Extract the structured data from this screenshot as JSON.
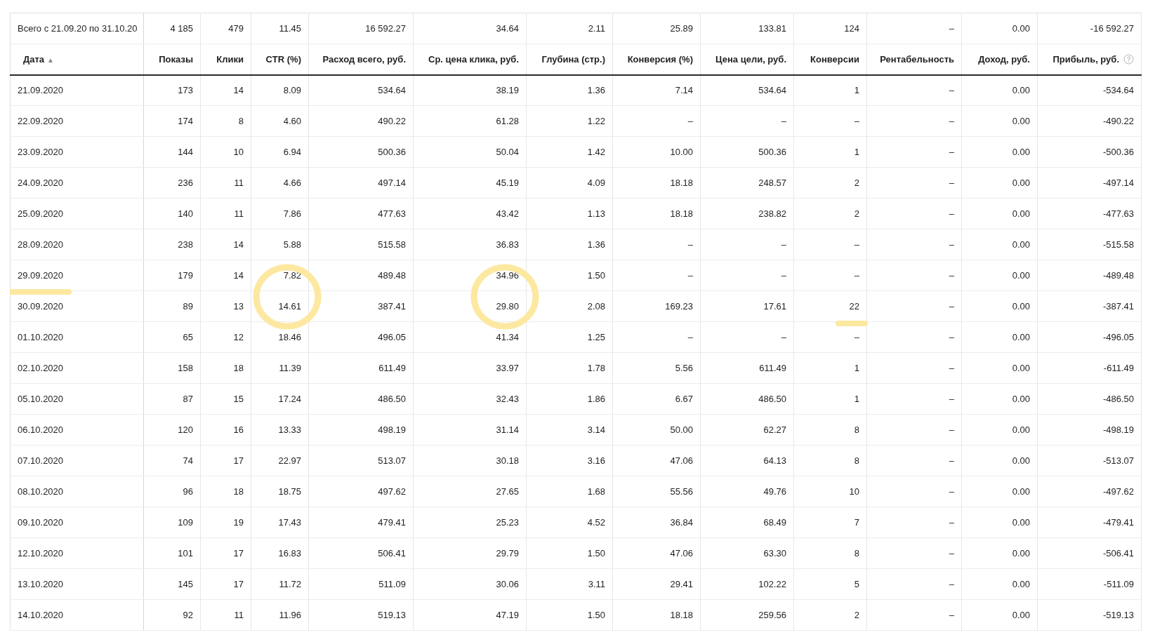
{
  "table": {
    "totals": [
      "Всего с 21.09.20 по 31.10.20",
      "4 185",
      "479",
      "11.45",
      "16 592.27",
      "34.64",
      "2.11",
      "25.89",
      "133.81",
      "124",
      "–",
      "0.00",
      "-16 592.27"
    ],
    "columns": [
      {
        "label": "Дата",
        "sort_indicator": "▲",
        "help_icon": false
      },
      {
        "label": "Показы",
        "help_icon": false
      },
      {
        "label": "Клики",
        "help_icon": false
      },
      {
        "label": "CTR (%)",
        "help_icon": false
      },
      {
        "label": "Расход всего, руб.",
        "help_icon": false
      },
      {
        "label": "Ср. цена клика, руб.",
        "help_icon": false
      },
      {
        "label": "Глубина (стр.)",
        "help_icon": false
      },
      {
        "label": "Конверсия (%)",
        "help_icon": false
      },
      {
        "label": "Цена цели, руб.",
        "help_icon": false
      },
      {
        "label": "Конверсии",
        "help_icon": false
      },
      {
        "label": "Рентабельность",
        "help_icon": false
      },
      {
        "label": "Доход, руб.",
        "help_icon": false
      },
      {
        "label": "Прибыль, руб.",
        "help_icon": true
      }
    ],
    "rows": [
      {
        "cells": [
          "21.09.2020",
          "173",
          "14",
          "8.09",
          "534.64",
          "38.19",
          "1.36",
          "7.14",
          "534.64",
          "1",
          "–",
          "0.00",
          "-534.64"
        ],
        "date_underlined": false,
        "ctr_circled": false,
        "cpc_circled": false,
        "conversions_underlined": false
      },
      {
        "cells": [
          "22.09.2020",
          "174",
          "8",
          "4.60",
          "490.22",
          "61.28",
          "1.22",
          "–",
          "–",
          "–",
          "–",
          "0.00",
          "-490.22"
        ],
        "date_underlined": false,
        "ctr_circled": false,
        "cpc_circled": false,
        "conversions_underlined": false
      },
      {
        "cells": [
          "23.09.2020",
          "144",
          "10",
          "6.94",
          "500.36",
          "50.04",
          "1.42",
          "10.00",
          "500.36",
          "1",
          "–",
          "0.00",
          "-500.36"
        ],
        "date_underlined": false,
        "ctr_circled": false,
        "cpc_circled": false,
        "conversions_underlined": false
      },
      {
        "cells": [
          "24.09.2020",
          "236",
          "11",
          "4.66",
          "497.14",
          "45.19",
          "4.09",
          "18.18",
          "248.57",
          "2",
          "–",
          "0.00",
          "-497.14"
        ],
        "date_underlined": false,
        "ctr_circled": false,
        "cpc_circled": false,
        "conversions_underlined": false
      },
      {
        "cells": [
          "25.09.2020",
          "140",
          "11",
          "7.86",
          "477.63",
          "43.42",
          "1.13",
          "18.18",
          "238.82",
          "2",
          "–",
          "0.00",
          "-477.63"
        ],
        "date_underlined": false,
        "ctr_circled": false,
        "cpc_circled": false,
        "conversions_underlined": false
      },
      {
        "cells": [
          "28.09.2020",
          "238",
          "14",
          "5.88",
          "515.58",
          "36.83",
          "1.36",
          "–",
          "–",
          "–",
          "–",
          "0.00",
          "-515.58"
        ],
        "date_underlined": false,
        "ctr_circled": false,
        "cpc_circled": false,
        "conversions_underlined": false
      },
      {
        "cells": [
          "29.09.2020",
          "179",
          "14",
          "7.82",
          "489.48",
          "34.96",
          "1.50",
          "–",
          "–",
          "–",
          "–",
          "0.00",
          "-489.48"
        ],
        "date_underlined": true,
        "ctr_circled": true,
        "cpc_circled": true,
        "conversions_underlined": false
      },
      {
        "cells": [
          "30.09.2020",
          "89",
          "13",
          "14.61",
          "387.41",
          "29.80",
          "2.08",
          "169.23",
          "17.61",
          "22",
          "–",
          "0.00",
          "-387.41"
        ],
        "date_underlined": false,
        "ctr_circled": true,
        "cpc_circled": true,
        "conversions_underlined": true
      },
      {
        "cells": [
          "01.10.2020",
          "65",
          "12",
          "18.46",
          "496.05",
          "41.34",
          "1.25",
          "–",
          "–",
          "–",
          "–",
          "0.00",
          "-496.05"
        ],
        "date_underlined": false,
        "ctr_circled": false,
        "cpc_circled": false,
        "conversions_underlined": false
      },
      {
        "cells": [
          "02.10.2020",
          "158",
          "18",
          "11.39",
          "611.49",
          "33.97",
          "1.78",
          "5.56",
          "611.49",
          "1",
          "–",
          "0.00",
          "-611.49"
        ],
        "date_underlined": false,
        "ctr_circled": false,
        "cpc_circled": false,
        "conversions_underlined": false
      },
      {
        "cells": [
          "05.10.2020",
          "87",
          "15",
          "17.24",
          "486.50",
          "32.43",
          "1.86",
          "6.67",
          "486.50",
          "1",
          "–",
          "0.00",
          "-486.50"
        ],
        "date_underlined": false,
        "ctr_circled": false,
        "cpc_circled": false,
        "conversions_underlined": false
      },
      {
        "cells": [
          "06.10.2020",
          "120",
          "16",
          "13.33",
          "498.19",
          "31.14",
          "3.14",
          "50.00",
          "62.27",
          "8",
          "–",
          "0.00",
          "-498.19"
        ],
        "date_underlined": false,
        "ctr_circled": false,
        "cpc_circled": false,
        "conversions_underlined": false
      },
      {
        "cells": [
          "07.10.2020",
          "74",
          "17",
          "22.97",
          "513.07",
          "30.18",
          "3.16",
          "47.06",
          "64.13",
          "8",
          "–",
          "0.00",
          "-513.07"
        ],
        "date_underlined": false,
        "ctr_circled": false,
        "cpc_circled": false,
        "conversions_underlined": false
      },
      {
        "cells": [
          "08.10.2020",
          "96",
          "18",
          "18.75",
          "497.62",
          "27.65",
          "1.68",
          "55.56",
          "49.76",
          "10",
          "–",
          "0.00",
          "-497.62"
        ],
        "date_underlined": false,
        "ctr_circled": false,
        "cpc_circled": false,
        "conversions_underlined": false
      },
      {
        "cells": [
          "09.10.2020",
          "109",
          "19",
          "17.43",
          "479.41",
          "25.23",
          "4.52",
          "36.84",
          "68.49",
          "7",
          "–",
          "0.00",
          "-479.41"
        ],
        "date_underlined": false,
        "ctr_circled": false,
        "cpc_circled": false,
        "conversions_underlined": false
      },
      {
        "cells": [
          "12.10.2020",
          "101",
          "17",
          "16.83",
          "506.41",
          "29.79",
          "1.50",
          "47.06",
          "63.30",
          "8",
          "–",
          "0.00",
          "-506.41"
        ],
        "date_underlined": false,
        "ctr_circled": false,
        "cpc_circled": false,
        "conversions_underlined": false
      },
      {
        "cells": [
          "13.10.2020",
          "145",
          "17",
          "11.72",
          "511.09",
          "30.06",
          "3.11",
          "29.41",
          "102.22",
          "5",
          "–",
          "0.00",
          "-511.09"
        ],
        "date_underlined": false,
        "ctr_circled": false,
        "cpc_circled": false,
        "conversions_underlined": false
      },
      {
        "cells": [
          "14.10.2020",
          "92",
          "11",
          "11.96",
          "519.13",
          "47.19",
          "1.50",
          "18.18",
          "259.56",
          "2",
          "–",
          "0.00",
          "-519.13"
        ],
        "date_underlined": false,
        "ctr_circled": false,
        "cpc_circled": false,
        "conversions_underlined": false
      }
    ]
  }
}
